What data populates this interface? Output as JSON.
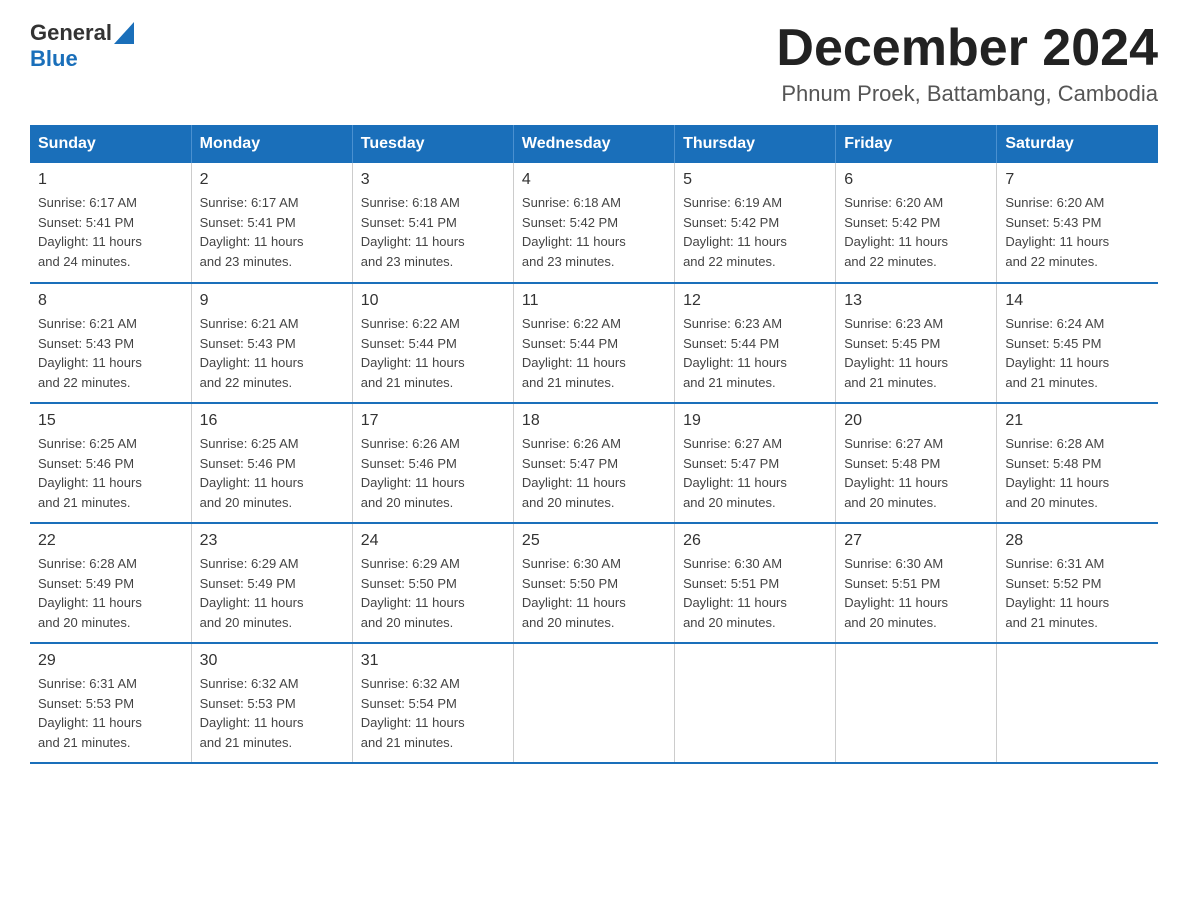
{
  "header": {
    "logo": {
      "general": "General",
      "blue": "Blue"
    },
    "title": "December 2024",
    "location": "Phnum Proek, Battambang, Cambodia"
  },
  "calendar": {
    "days_of_week": [
      "Sunday",
      "Monday",
      "Tuesday",
      "Wednesday",
      "Thursday",
      "Friday",
      "Saturday"
    ],
    "weeks": [
      [
        {
          "day": "1",
          "sunrise": "6:17 AM",
          "sunset": "5:41 PM",
          "daylight": "11 hours and 24 minutes."
        },
        {
          "day": "2",
          "sunrise": "6:17 AM",
          "sunset": "5:41 PM",
          "daylight": "11 hours and 23 minutes."
        },
        {
          "day": "3",
          "sunrise": "6:18 AM",
          "sunset": "5:41 PM",
          "daylight": "11 hours and 23 minutes."
        },
        {
          "day": "4",
          "sunrise": "6:18 AM",
          "sunset": "5:42 PM",
          "daylight": "11 hours and 23 minutes."
        },
        {
          "day": "5",
          "sunrise": "6:19 AM",
          "sunset": "5:42 PM",
          "daylight": "11 hours and 22 minutes."
        },
        {
          "day": "6",
          "sunrise": "6:20 AM",
          "sunset": "5:42 PM",
          "daylight": "11 hours and 22 minutes."
        },
        {
          "day": "7",
          "sunrise": "6:20 AM",
          "sunset": "5:43 PM",
          "daylight": "11 hours and 22 minutes."
        }
      ],
      [
        {
          "day": "8",
          "sunrise": "6:21 AM",
          "sunset": "5:43 PM",
          "daylight": "11 hours and 22 minutes."
        },
        {
          "day": "9",
          "sunrise": "6:21 AM",
          "sunset": "5:43 PM",
          "daylight": "11 hours and 22 minutes."
        },
        {
          "day": "10",
          "sunrise": "6:22 AM",
          "sunset": "5:44 PM",
          "daylight": "11 hours and 21 minutes."
        },
        {
          "day": "11",
          "sunrise": "6:22 AM",
          "sunset": "5:44 PM",
          "daylight": "11 hours and 21 minutes."
        },
        {
          "day": "12",
          "sunrise": "6:23 AM",
          "sunset": "5:44 PM",
          "daylight": "11 hours and 21 minutes."
        },
        {
          "day": "13",
          "sunrise": "6:23 AM",
          "sunset": "5:45 PM",
          "daylight": "11 hours and 21 minutes."
        },
        {
          "day": "14",
          "sunrise": "6:24 AM",
          "sunset": "5:45 PM",
          "daylight": "11 hours and 21 minutes."
        }
      ],
      [
        {
          "day": "15",
          "sunrise": "6:25 AM",
          "sunset": "5:46 PM",
          "daylight": "11 hours and 21 minutes."
        },
        {
          "day": "16",
          "sunrise": "6:25 AM",
          "sunset": "5:46 PM",
          "daylight": "11 hours and 20 minutes."
        },
        {
          "day": "17",
          "sunrise": "6:26 AM",
          "sunset": "5:46 PM",
          "daylight": "11 hours and 20 minutes."
        },
        {
          "day": "18",
          "sunrise": "6:26 AM",
          "sunset": "5:47 PM",
          "daylight": "11 hours and 20 minutes."
        },
        {
          "day": "19",
          "sunrise": "6:27 AM",
          "sunset": "5:47 PM",
          "daylight": "11 hours and 20 minutes."
        },
        {
          "day": "20",
          "sunrise": "6:27 AM",
          "sunset": "5:48 PM",
          "daylight": "11 hours and 20 minutes."
        },
        {
          "day": "21",
          "sunrise": "6:28 AM",
          "sunset": "5:48 PM",
          "daylight": "11 hours and 20 minutes."
        }
      ],
      [
        {
          "day": "22",
          "sunrise": "6:28 AM",
          "sunset": "5:49 PM",
          "daylight": "11 hours and 20 minutes."
        },
        {
          "day": "23",
          "sunrise": "6:29 AM",
          "sunset": "5:49 PM",
          "daylight": "11 hours and 20 minutes."
        },
        {
          "day": "24",
          "sunrise": "6:29 AM",
          "sunset": "5:50 PM",
          "daylight": "11 hours and 20 minutes."
        },
        {
          "day": "25",
          "sunrise": "6:30 AM",
          "sunset": "5:50 PM",
          "daylight": "11 hours and 20 minutes."
        },
        {
          "day": "26",
          "sunrise": "6:30 AM",
          "sunset": "5:51 PM",
          "daylight": "11 hours and 20 minutes."
        },
        {
          "day": "27",
          "sunrise": "6:30 AM",
          "sunset": "5:51 PM",
          "daylight": "11 hours and 20 minutes."
        },
        {
          "day": "28",
          "sunrise": "6:31 AM",
          "sunset": "5:52 PM",
          "daylight": "11 hours and 21 minutes."
        }
      ],
      [
        {
          "day": "29",
          "sunrise": "6:31 AM",
          "sunset": "5:53 PM",
          "daylight": "11 hours and 21 minutes."
        },
        {
          "day": "30",
          "sunrise": "6:32 AM",
          "sunset": "5:53 PM",
          "daylight": "11 hours and 21 minutes."
        },
        {
          "day": "31",
          "sunrise": "6:32 AM",
          "sunset": "5:54 PM",
          "daylight": "11 hours and 21 minutes."
        },
        null,
        null,
        null,
        null
      ]
    ]
  }
}
